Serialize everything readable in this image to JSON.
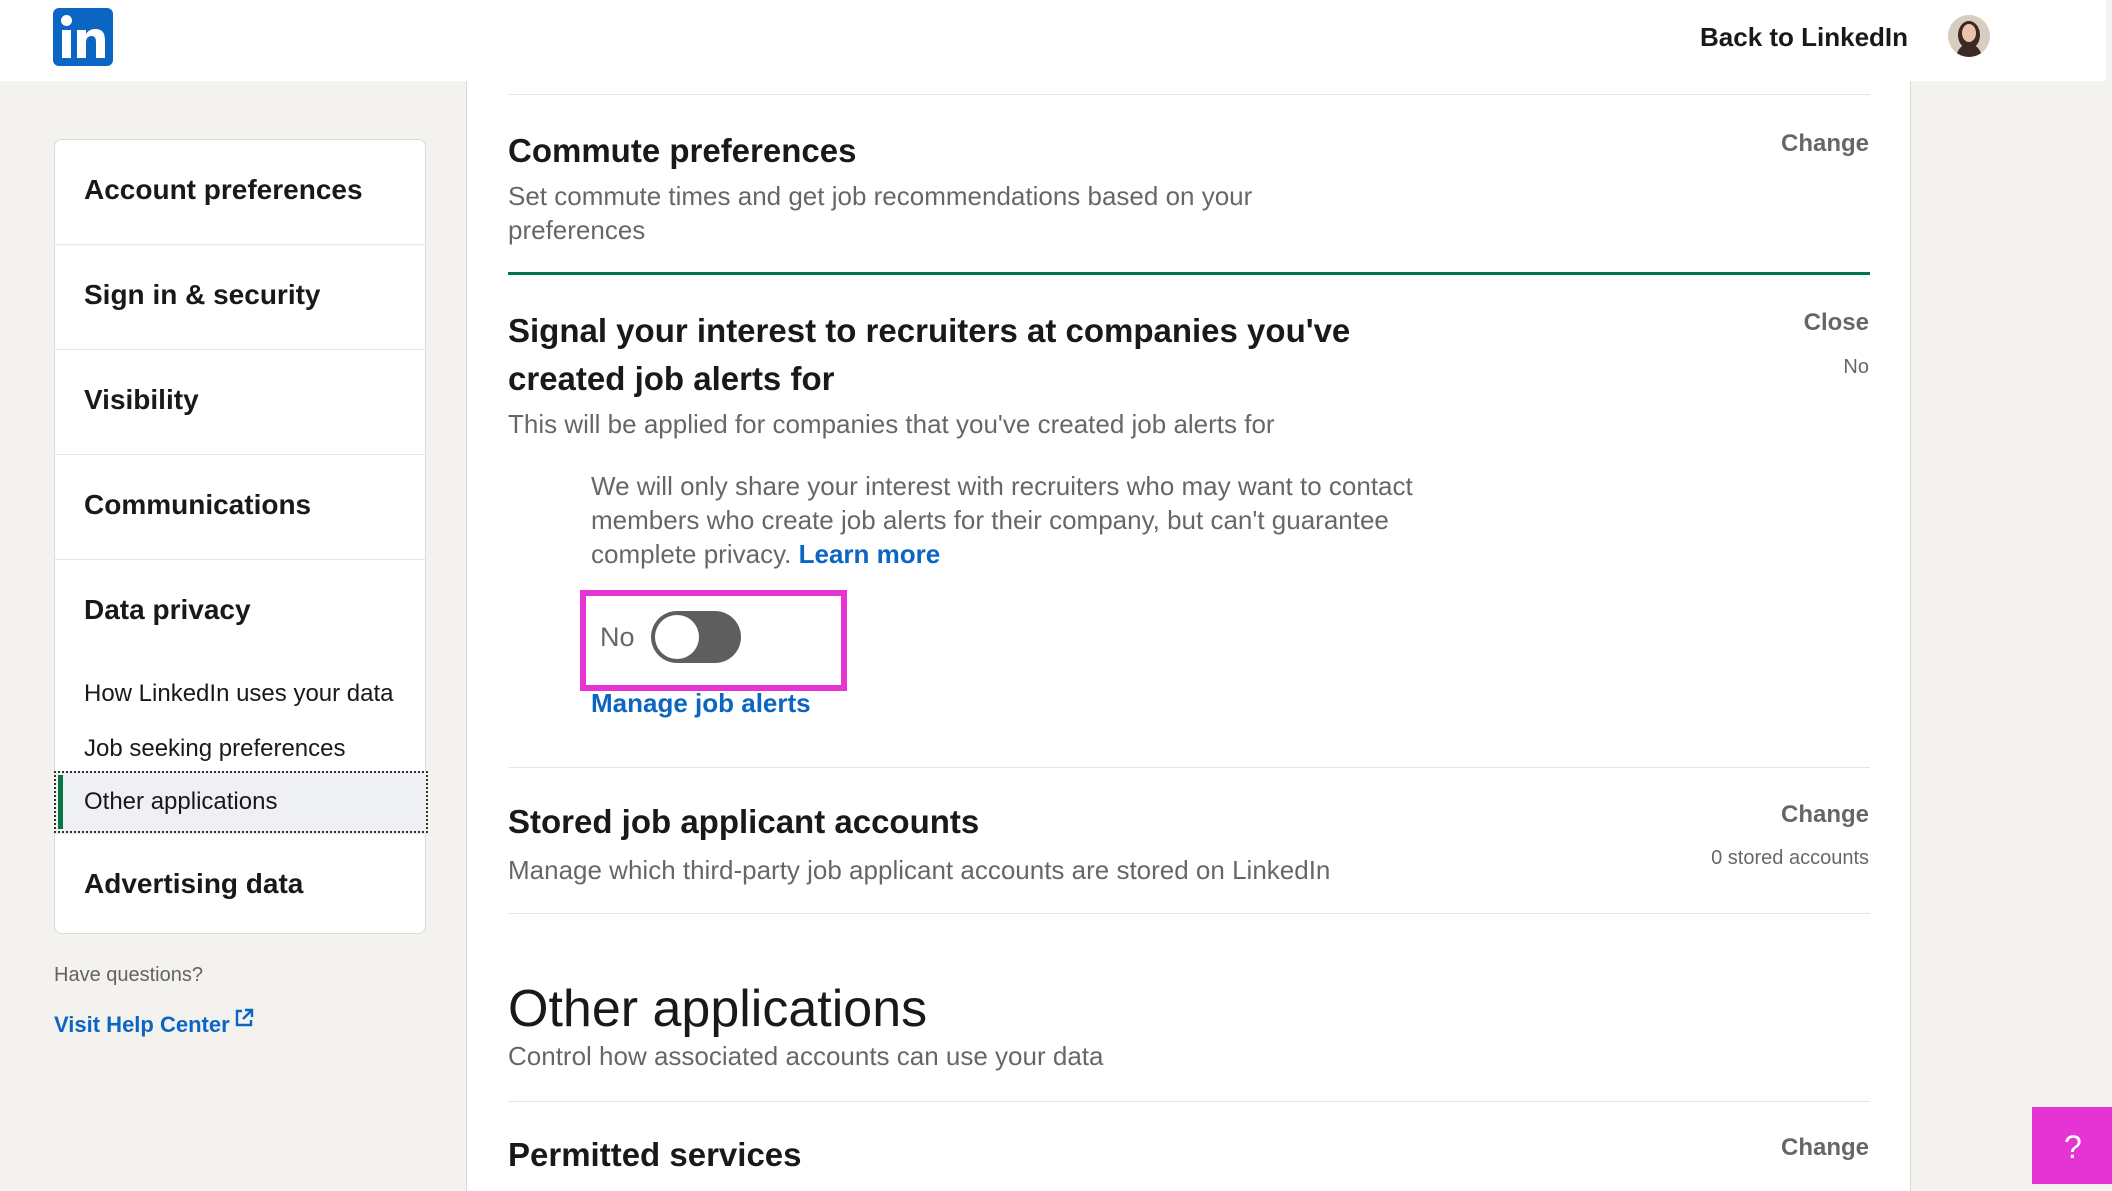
{
  "header": {
    "back_label": "Back to LinkedIn"
  },
  "sidebar": {
    "items": [
      {
        "label": "Account preferences"
      },
      {
        "label": "Sign in & security"
      },
      {
        "label": "Visibility"
      },
      {
        "label": "Communications"
      },
      {
        "label": "Data privacy"
      }
    ],
    "sub_items": [
      {
        "label": "How LinkedIn uses your data"
      },
      {
        "label": "Job seeking preferences"
      },
      {
        "label": "Other applications"
      }
    ],
    "last_item": {
      "label": "Advertising data"
    },
    "help_question": "Have questions?",
    "help_link": "Visit Help Center"
  },
  "main": {
    "commute": {
      "title": "Commute preferences",
      "desc_line1": "Set commute times and get job recommendations based on your",
      "desc_line2": "preferences",
      "action": "Change"
    },
    "signal": {
      "title_line1": "Signal your interest to recruiters at companies you've",
      "title_line2": "created job alerts for",
      "desc": "This will be applied for companies that you've created job alerts for",
      "action": "Close",
      "status": "No",
      "info": "We will only share your interest with recruiters who may want to contact members who create job alerts for their company, but can't guarantee complete privacy.",
      "learn_more": "Learn more",
      "toggle_label": "No",
      "toggle_on": false,
      "manage_link": "Manage job alerts"
    },
    "stored": {
      "title": "Stored job applicant accounts",
      "desc": "Manage which third-party job applicant accounts are stored on LinkedIn",
      "action": "Change",
      "status": "0 stored accounts"
    },
    "other_apps": {
      "title": "Other applications",
      "desc": "Control how associated accounts can use your data"
    },
    "permitted": {
      "title": "Permitted services",
      "action": "Change"
    }
  },
  "help_widget": {
    "label": "?"
  },
  "colors": {
    "brand": "#0a66c2",
    "accent_green": "#01754f",
    "highlight": "#e634d4"
  }
}
